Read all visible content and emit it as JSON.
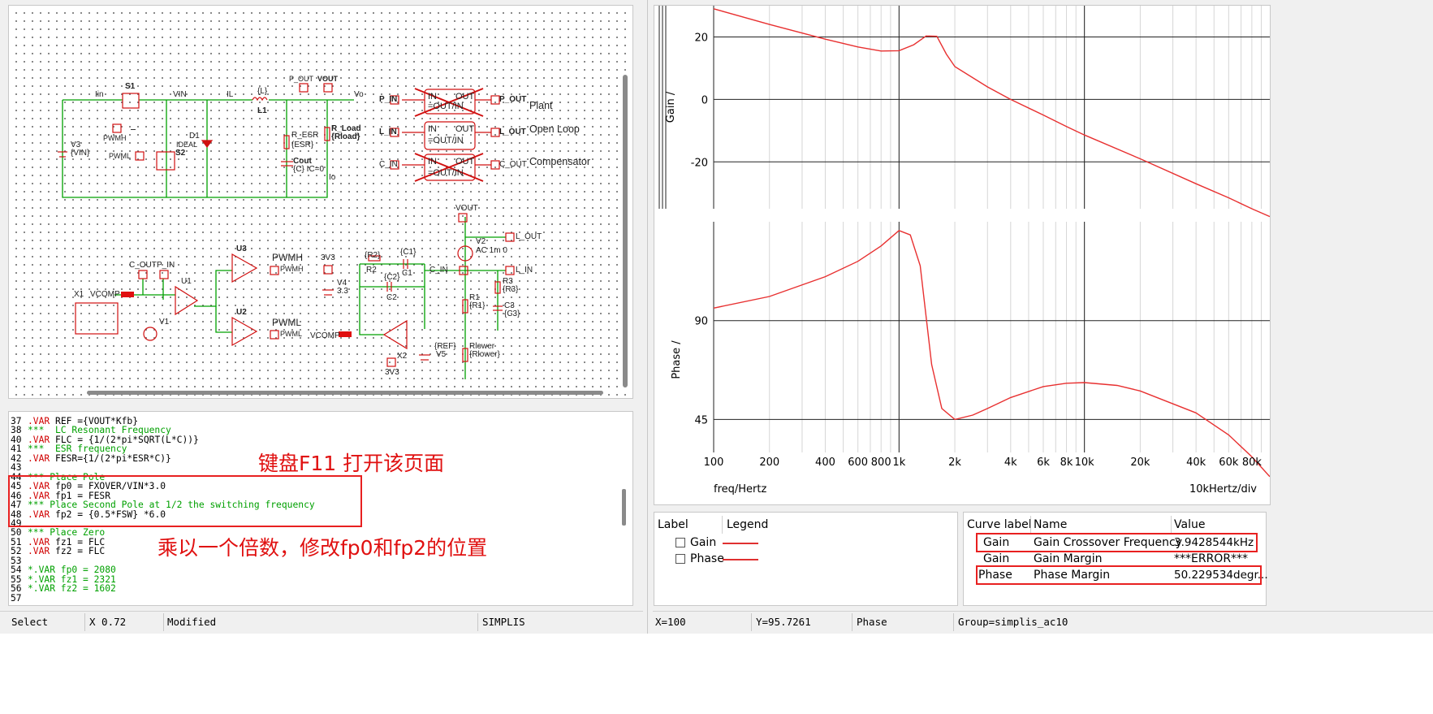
{
  "schematic": {
    "labels": {
      "iin": "Iin",
      "s1": "S1",
      "vin": "VIN",
      "il": "IL",
      "l1_top": "{L}",
      "l1": "L1",
      "p_out_node": "P_OUT",
      "vout_node": "VOUT",
      "vo": "Vo",
      "pwmh": "PWMH",
      "pwml": "PWML",
      "s2": "S2",
      "d1": "D1",
      "ideal": "IDEAL",
      "v3": "V3",
      "v3_val": "{VIN}",
      "r_esr": "R_ESR",
      "r_esr_val": "{ESR}",
      "cout": "Cout",
      "cout_val": "{C} IC=0",
      "r_load": "R_Load",
      "r_load_val": "{Rload}",
      "io": "Io",
      "p_in": "P_IN",
      "p_out": "P_OUT",
      "l_in": "L_IN",
      "l_out": "L_OUT",
      "c_in": "C_IN",
      "c_out": "C_OUT",
      "blk_in": "IN",
      "blk_out": "OUT",
      "blk_eq1": "=OUT/IN",
      "blk_eq2": "=OUT/IN",
      "blk_eq3": "=OUT/IN",
      "plant": "Plant",
      "open_loop": "Open Loop",
      "compensator": "Compensator",
      "c_out_lbl": "C_OUT",
      "p_in_lbl": "P_IN",
      "u1": "U1",
      "u2": "U2",
      "u3": "U3",
      "x1": "X1",
      "vcomp": "VCOMP",
      "v1": "V1",
      "pwmh_out": "PWMH",
      "pwmh_out2": "PWMH",
      "pwml_out": "PWML",
      "pwml_out2": "PWML",
      "v4_3v3": "3V3",
      "v4": "V4",
      "v4_val": "3.3",
      "r2_val": "{R2}",
      "r2": "R2",
      "c1_val": "{C1}",
      "c1": "C1",
      "c2_val": "{C2}",
      "c2": "C2",
      "c_in_lbl": "C_IN",
      "vcomp2": "VCOMP",
      "x2": "X2",
      "x2_3v3": "3V3",
      "ref": "{REF}",
      "v5": "V5",
      "vout2": "VOUT",
      "v2": "V2",
      "v2_val": "AC 1m 0",
      "l_out2": "L_OUT",
      "l_in2": "L_IN",
      "r1": "R1",
      "r1_val": "{R1}",
      "r3": "R3",
      "r3_val": "{R3}",
      "c3": "C3",
      "c3_val": "{C3}",
      "rlower": "Rlower",
      "rlower_val": "{Rlower}"
    }
  },
  "script": {
    "lines": [
      {
        "n": "37",
        "parts": [
          {
            "t": ".VAR",
            "c": "var"
          },
          {
            "t": " REF ={VOUT*Kfb}",
            "c": "txt"
          }
        ]
      },
      {
        "n": "38",
        "parts": [
          {
            "t": "***  LC Resonant Frequency",
            "c": "com"
          }
        ]
      },
      {
        "n": "40",
        "parts": [
          {
            "t": ".VAR",
            "c": "var"
          },
          {
            "t": " FLC = {1/(2*pi*SQRT(L*C))}",
            "c": "txt"
          }
        ]
      },
      {
        "n": "41",
        "parts": [
          {
            "t": "***  ESR frequency",
            "c": "com"
          }
        ]
      },
      {
        "n": "42",
        "parts": [
          {
            "t": ".VAR",
            "c": "var"
          },
          {
            "t": " FESR={1/(2*pi*ESR*C)}",
            "c": "txt"
          }
        ]
      },
      {
        "n": "43",
        "parts": []
      },
      {
        "n": "44",
        "parts": [
          {
            "t": "*** Place Pole",
            "c": "com"
          }
        ]
      },
      {
        "n": "45",
        "parts": [
          {
            "t": ".VAR",
            "c": "var"
          },
          {
            "t": " fp0 = FXOVER/VIN*3.0",
            "c": "txt"
          }
        ]
      },
      {
        "n": "46",
        "parts": [
          {
            "t": ".VAR",
            "c": "var"
          },
          {
            "t": " fp1 = FESR",
            "c": "txt"
          }
        ]
      },
      {
        "n": "47",
        "parts": [
          {
            "t": "*** Place Second Pole at 1/2 the switching frequency",
            "c": "com"
          }
        ]
      },
      {
        "n": "48",
        "parts": [
          {
            "t": ".VAR",
            "c": "var"
          },
          {
            "t": " fp2 = {0.5*FSW} *6.0",
            "c": "txt"
          }
        ]
      },
      {
        "n": "49",
        "parts": []
      },
      {
        "n": "50",
        "parts": [
          {
            "t": "*** Place Zero",
            "c": "com"
          }
        ]
      },
      {
        "n": "51",
        "parts": [
          {
            "t": ".VAR",
            "c": "var"
          },
          {
            "t": " fz1 = FLC",
            "c": "txt"
          }
        ]
      },
      {
        "n": "52",
        "parts": [
          {
            "t": ".VAR",
            "c": "var"
          },
          {
            "t": " fz2 = FLC",
            "c": "txt"
          }
        ]
      },
      {
        "n": "53",
        "parts": []
      },
      {
        "n": "54",
        "parts": [
          {
            "t": "*.VAR fp0 = 2080",
            "c": "com"
          }
        ]
      },
      {
        "n": "55",
        "parts": [
          {
            "t": "*.VAR fz1 = 2321",
            "c": "com"
          }
        ]
      },
      {
        "n": "56",
        "parts": [
          {
            "t": "*.VAR fz2 = 1602",
            "c": "com"
          }
        ]
      },
      {
        "n": "57",
        "parts": []
      }
    ],
    "annotation_top": "键盘F11 打开该页面",
    "annotation_bottom": "乘以一个倍数，修改fp0和fp2的位置"
  },
  "status_left": {
    "mode": "Select",
    "x": "X 0.72",
    "modified": "Modified",
    "sim": "SIMPLIS"
  },
  "status_right": {
    "x": "X=100",
    "y": "Y=95.7261",
    "curve": "Phase",
    "group": "Group=simplis_ac10"
  },
  "colors": {
    "curve": "#e83030",
    "annotation": "#e01010",
    "comment": "#00a000",
    "keyword": "#d00000"
  },
  "chart_data": [
    {
      "type": "line",
      "title": "",
      "xlabel": "freq/Hertz",
      "ylabel": "Gain /",
      "x_scale": "log",
      "xlim": [
        100,
        100000
      ],
      "ylim": [
        -35,
        30
      ],
      "yticks": [
        20,
        0,
        -20
      ],
      "ytick_labels": [
        "20",
        "0",
        "-20"
      ],
      "grid": true,
      "series": [
        {
          "name": "Gain",
          "x": [
            100,
            200,
            400,
            600,
            800,
            1000,
            1200,
            1400,
            1600,
            1800,
            2000,
            3000,
            4000,
            6000,
            8000,
            10000,
            20000,
            40000,
            60000,
            80000,
            100000
          ],
          "y": [
            29,
            24,
            19.3,
            16.8,
            15.5,
            15.6,
            17.5,
            20.3,
            20.2,
            14.5,
            10.5,
            4,
            0,
            -5,
            -8.7,
            -11.4,
            -19,
            -27,
            -31.5,
            -35,
            -37.5
          ]
        }
      ]
    },
    {
      "type": "line",
      "title": "",
      "xlabel": "freq/Hertz",
      "ylabel": "Phase /",
      "x_scale": "log",
      "xlim": [
        100,
        100000
      ],
      "ylim": [
        30,
        135
      ],
      "yticks": [
        90,
        45
      ],
      "ytick_labels": [
        "90",
        "45"
      ],
      "xticks": [
        100,
        200,
        400,
        600,
        800,
        1000,
        2000,
        4000,
        6000,
        8000,
        10000,
        20000,
        40000,
        60000,
        80000
      ],
      "xtick_labels": [
        "100",
        "200",
        "400",
        "600",
        "800",
        "1k",
        "2k",
        "4k",
        "6k",
        "8k",
        "10k",
        "20k",
        "40k",
        "60k",
        "80k"
      ],
      "x_division_label": "10kHertz/div",
      "grid": true,
      "series": [
        {
          "name": "Phase",
          "x": [
            100,
            200,
            400,
            600,
            800,
            1000,
            1150,
            1300,
            1500,
            1700,
            2000,
            2500,
            3000,
            4000,
            6000,
            8000,
            10000,
            15000,
            20000,
            40000,
            60000,
            80000,
            100000
          ],
          "y": [
            95.7,
            101,
            110,
            117,
            124,
            131,
            129,
            115,
            70,
            50,
            45,
            47,
            50,
            55,
            60,
            61.5,
            61.8,
            60.5,
            58,
            48,
            38,
            28,
            19
          ]
        }
      ]
    }
  ],
  "legend": {
    "header_label": "Label",
    "header_legend": "Legend",
    "items": [
      {
        "label": "Gain"
      },
      {
        "label": "Phase"
      }
    ]
  },
  "measurements": {
    "headers": {
      "curve": "Curve label",
      "name": "Name",
      "value": "Value"
    },
    "rows": [
      {
        "curve": "Gain",
        "name": "Gain Crossover Frequency",
        "value": "3.9428544kHz"
      },
      {
        "curve": "Gain",
        "name": "Gain Margin",
        "value": "***ERROR***"
      },
      {
        "curve": "Phase",
        "name": "Phase Margin",
        "value": "50.229534degr..."
      }
    ]
  }
}
